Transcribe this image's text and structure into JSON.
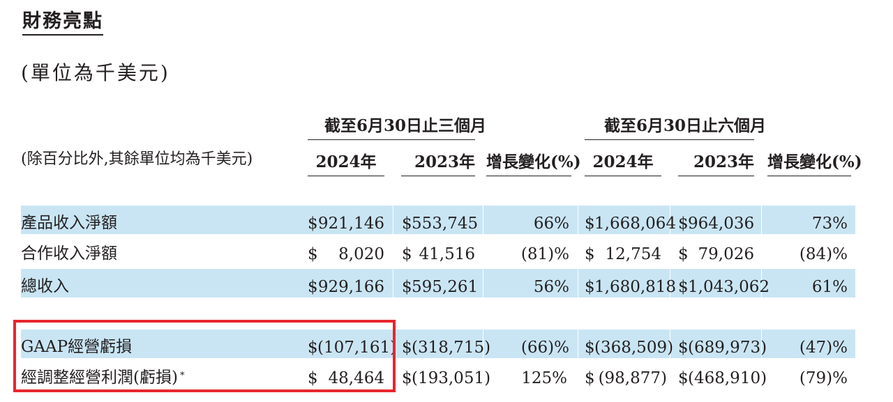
{
  "title": "財務亮點",
  "unit_note": "(單位為千美元)",
  "table": {
    "row_header_label": "(除百分比外,其餘單位均為千美元)",
    "group_headers": [
      "截至6月30日止三個月",
      "截至6月30日止六個月"
    ],
    "column_headers": [
      "2024年",
      "2023年",
      "增長變化(%)",
      "2024年",
      "2023年",
      "增長變化(%)"
    ],
    "currency_symbol": "$",
    "rows": [
      {
        "label": "產品收入淨額",
        "shaded": true,
        "q2024": "921,146",
        "q2023": "553,745",
        "q_change": "66%",
        "h2024": "1,668,064",
        "h2023": "964,036",
        "h_change": "73%"
      },
      {
        "label": "合作收入淨額",
        "shaded": false,
        "q2024": "8,020",
        "q2023": "41,516",
        "q_change": "(81)%",
        "h2024": "12,754",
        "h2023": "79,026",
        "h_change": "(84)%"
      },
      {
        "label": "總收入",
        "shaded": true,
        "q2024": "929,166",
        "q2023": "595,261",
        "q_change": "56%",
        "h2024": "1,680,818",
        "h2023": "1,043,062",
        "h_change": "61%"
      },
      {
        "label": "GAAP經營虧損",
        "shaded": true,
        "q2024": "(107,161)",
        "q2023": "(318,715)",
        "q_change": "(66)%",
        "h2024": "(368,509)",
        "h2023": "(689,973)",
        "h_change": "(47)%"
      },
      {
        "label": "經調整經營利潤(虧損)",
        "footnote": "*",
        "shaded": false,
        "q2024": "48,464",
        "q2023": "(193,051)",
        "q_change": "125%",
        "h2024": "(98,877)",
        "h2023": "(468,910)",
        "h_change": "(79)%"
      }
    ]
  },
  "colors": {
    "row_shading": "#c9e5f4",
    "highlight_border": "#e8262e",
    "text": "#231f20"
  }
}
